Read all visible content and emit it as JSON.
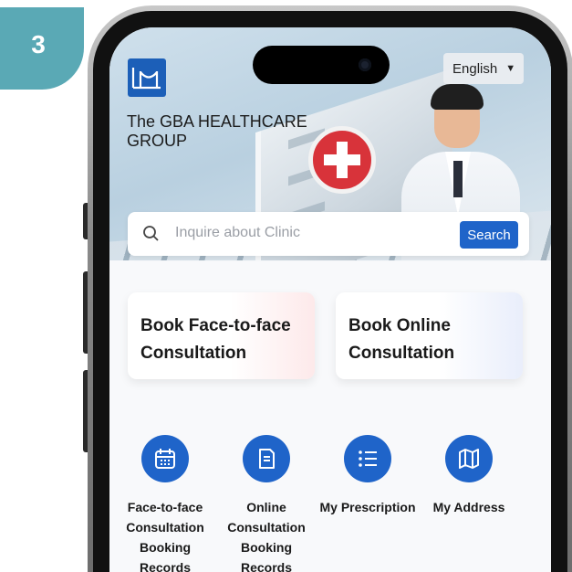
{
  "step": {
    "number": "3"
  },
  "header": {
    "brand_name": "The GBA HEALTHCARE GROUP",
    "language": "English"
  },
  "search": {
    "placeholder": "Inquire about Clinic",
    "button_label": "Search"
  },
  "cards": [
    {
      "label": "Book Face-to-face Consultation"
    },
    {
      "label": "Book Online Consultation"
    }
  ],
  "actions": [
    {
      "label": "Face-to-face Consultation Booking Records",
      "icon": "calendar-icon"
    },
    {
      "label": "Online Consultation Booking Records",
      "icon": "document-icon"
    },
    {
      "label": "My Prescription",
      "icon": "list-icon"
    },
    {
      "label": "My Address",
      "icon": "map-icon"
    }
  ],
  "colors": {
    "accent": "#1f64c9",
    "badge": "#5aa9b5",
    "cross_red": "#d8333a"
  }
}
